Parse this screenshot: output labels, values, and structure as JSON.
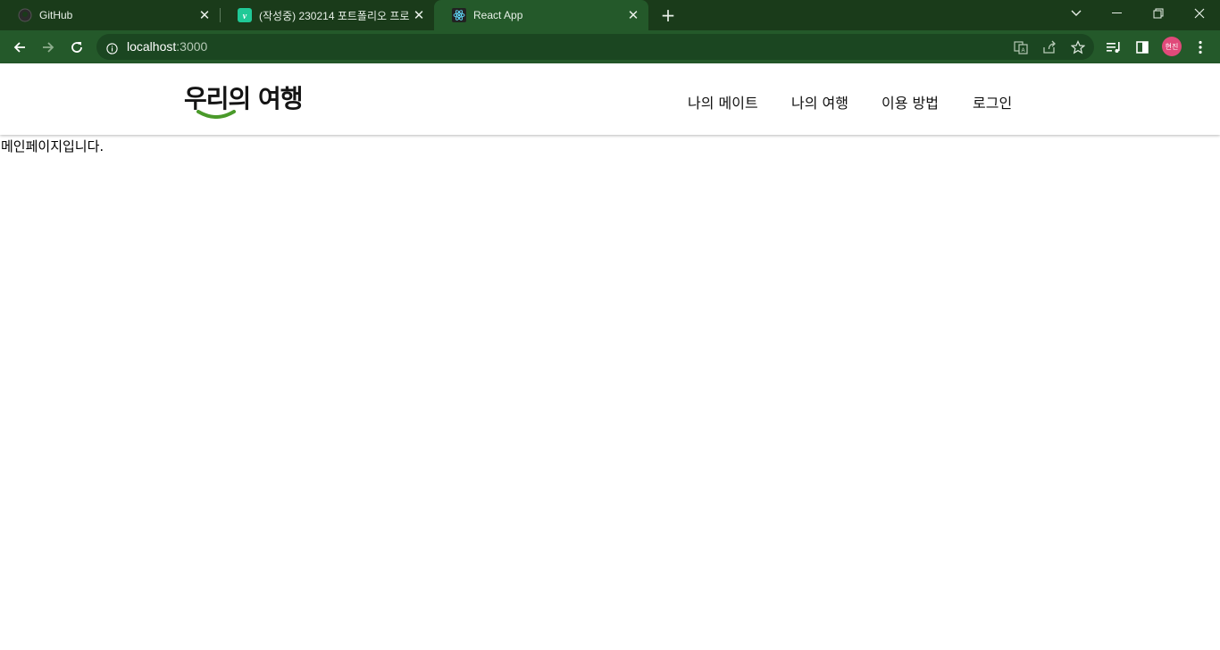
{
  "browser": {
    "tabs": [
      {
        "title": "GitHub",
        "favicon": "github-icon",
        "active": false
      },
      {
        "title": "(작성중) 230214 포트폴리오 프로",
        "favicon": "velog-icon",
        "active": false
      },
      {
        "title": "React App",
        "favicon": "react-icon",
        "active": true
      }
    ],
    "new_tab_symbol": "+",
    "address": {
      "host": "localhost",
      "port": ":3000"
    },
    "profile_initials": "현진",
    "theme_color": "#24592a"
  },
  "site": {
    "logo_text": "우리의 여행",
    "logo_accent_color": "#4a9a2a",
    "nav": [
      {
        "label": "나의 메이트"
      },
      {
        "label": "나의 여행"
      },
      {
        "label": "이용 방법"
      },
      {
        "label": "로그인"
      }
    ]
  },
  "main": {
    "text": "메인페이지입니다."
  }
}
